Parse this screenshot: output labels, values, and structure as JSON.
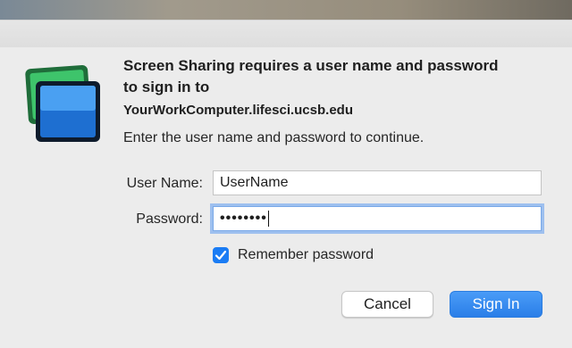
{
  "dialog": {
    "heading": "Screen Sharing requires a user name and password to sign in to",
    "host": "YourWorkComputer.lifesci.ucsb.edu",
    "instruction": "Enter the user name and password to continue."
  },
  "form": {
    "username_label": "User Name:",
    "username_value": "UserName",
    "password_label": "Password:",
    "password_value": "••••••••",
    "remember_label": "Remember password",
    "remember_checked": true
  },
  "buttons": {
    "cancel": "Cancel",
    "sign_in": "Sign In"
  },
  "icons": {
    "app": "screen-sharing-icon",
    "check": "checkmark-icon"
  },
  "colors": {
    "accent": "#1a7cf4",
    "dialog_bg": "#ececec"
  }
}
